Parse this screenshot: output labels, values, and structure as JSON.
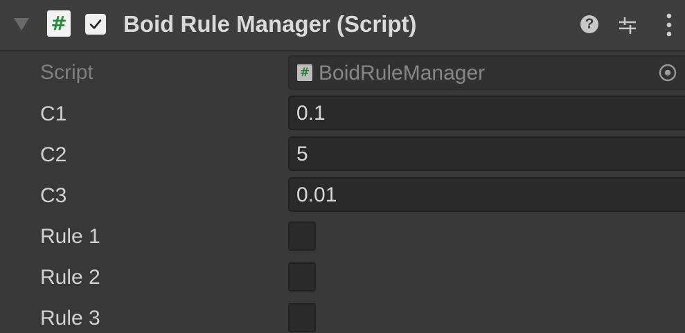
{
  "component": {
    "title": "Boid Rule Manager (Script)",
    "script_icon_glyph": "#",
    "enabled": true
  },
  "properties": {
    "script": {
      "label": "Script",
      "value": "BoidRuleManager"
    },
    "c1": {
      "label": "C1",
      "value": "0.1"
    },
    "c2": {
      "label": "C2",
      "value": "5"
    },
    "c3": {
      "label": "C3",
      "value": "0.01"
    },
    "rule1": {
      "label": "Rule 1",
      "checked": false
    },
    "rule2": {
      "label": "Rule 2",
      "checked": false
    },
    "rule3": {
      "label": "Rule 3",
      "checked": false
    }
  },
  "icons": {
    "foldout": "foldout-arrow-icon",
    "script": "csharp-script-icon",
    "help": "help-icon",
    "presets": "presets-icon",
    "menu": "kebab-menu-icon",
    "object_picker": "object-picker-icon"
  },
  "colors": {
    "background": "#383838",
    "header": "#3e3e3e",
    "field": "#2a2a2a",
    "label": "#d2d2d2",
    "script_icon_green": "#2b8a3e"
  }
}
